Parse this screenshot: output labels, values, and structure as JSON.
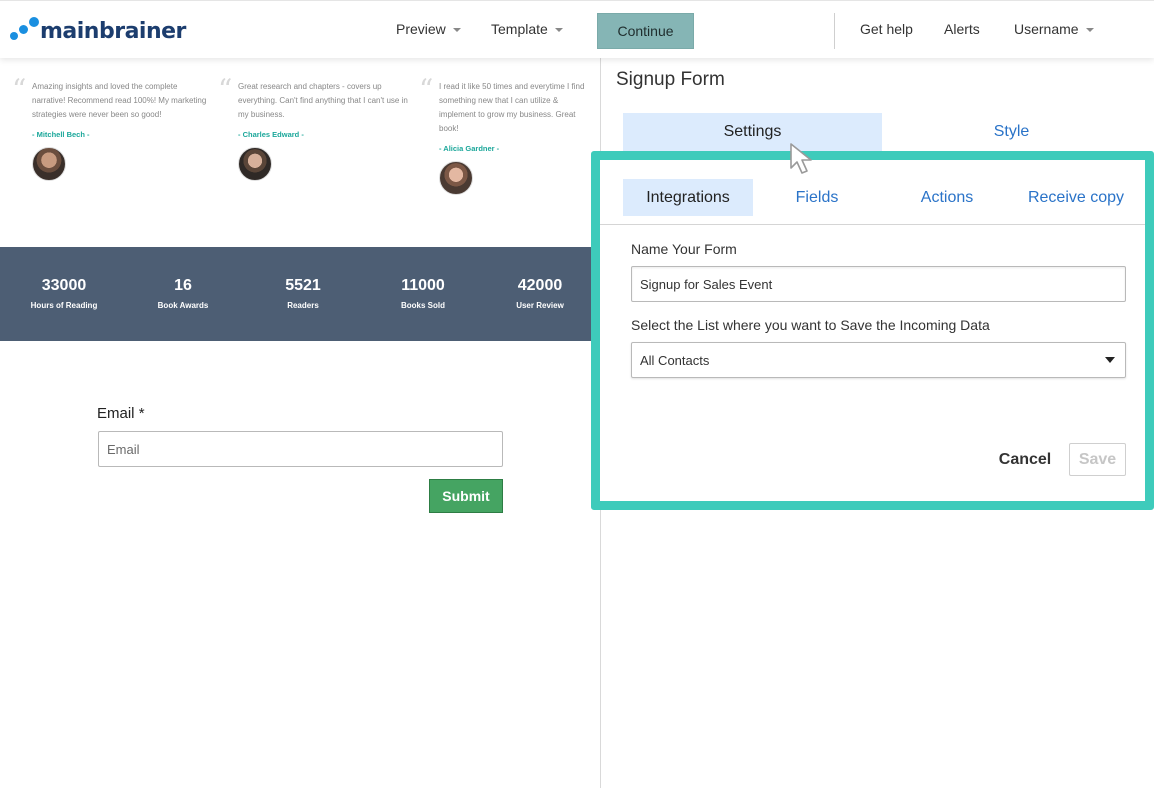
{
  "header": {
    "logo_text": "mainbrainer",
    "nav": {
      "preview": "Preview",
      "template": "Template",
      "continue": "Continue",
      "get_help": "Get help",
      "alerts": "Alerts",
      "username": "Username"
    }
  },
  "preview": {
    "testimonials": [
      {
        "text": "Amazing insights and loved the complete narrative! Recommend read 100%! My marketing strategies were never been so good!",
        "author": "- Mitchell Bech -"
      },
      {
        "text": "Great research and chapters - covers up everything. Can't find anything that I can't use in my business.",
        "author": "- Charles Edward -"
      },
      {
        "text": "I read it like 50 times and everytime I find something new that I can utilize & implement to grow my business. Great book!",
        "author": "- Alicia Gardner -"
      }
    ],
    "stats": [
      {
        "value": "33000",
        "label": "Hours of Reading"
      },
      {
        "value": "16",
        "label": "Book Awards"
      },
      {
        "value": "5521",
        "label": "Readers"
      },
      {
        "value": "11000",
        "label": "Books Sold"
      },
      {
        "value": "42000",
        "label": "User Review"
      }
    ],
    "form": {
      "email_label": "Email",
      "required_mark": "*",
      "email_placeholder": "Email",
      "submit_label": "Submit"
    }
  },
  "panel": {
    "title": "Signup Form",
    "tabs": {
      "settings": "Settings",
      "style": "Style"
    },
    "sub_tabs": {
      "integrations": "Integrations",
      "fields": "Fields",
      "actions": "Actions",
      "receive_copy": "Receive copy"
    },
    "name_label": "Name Your Form",
    "name_value": "Signup for Sales Event",
    "list_label": "Select the List where you want to Save the Incoming Data",
    "list_value": "All Contacts",
    "cancel": "Cancel",
    "save": "Save"
  },
  "colors": {
    "accent_highlight": "#3ecbbb",
    "tab_active_bg": "#dcebfd",
    "link_blue": "#2a73c8",
    "stats_bg": "#4d5e74",
    "submit_green": "#45a462",
    "continue_bg": "#85b5b5",
    "brand_blue": "#1a8fe0"
  },
  "icons": [
    "logo-dots-icon",
    "caret-down-icon",
    "quote-icon",
    "dropdown-arrow-icon",
    "mouse-cursor-icon"
  ]
}
